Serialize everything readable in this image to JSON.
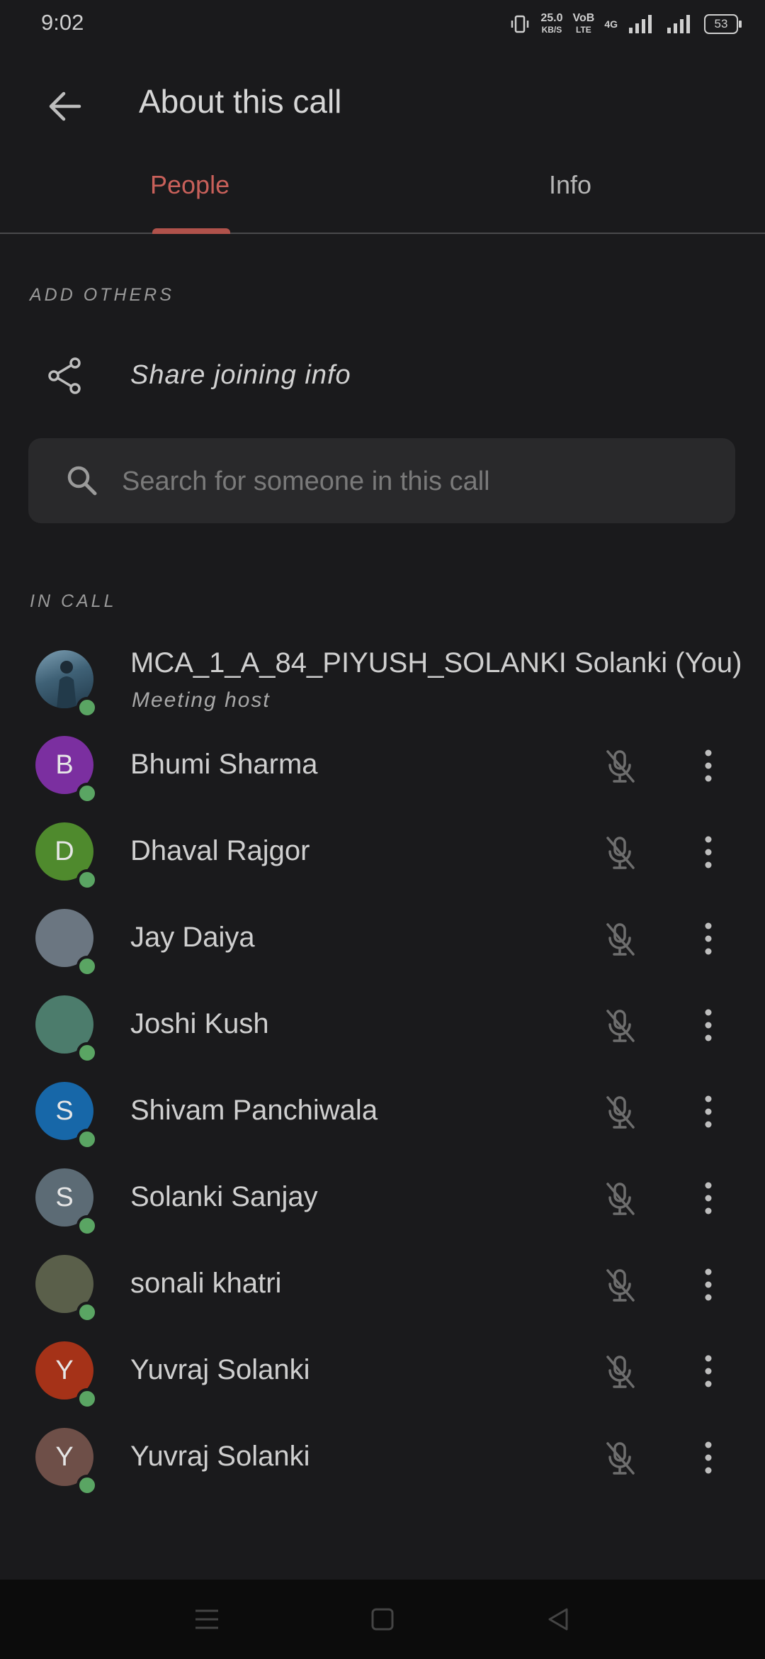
{
  "status_bar": {
    "time": "9:02",
    "speed_value": "25.0",
    "speed_unit": "KB/S",
    "volte_top": "VoB",
    "volte_bottom": "LTE",
    "network": "4G",
    "battery": "53"
  },
  "app_bar": {
    "title": "About this call",
    "back_icon": "arrow-back-icon"
  },
  "tabs": [
    {
      "label": "People",
      "active": true
    },
    {
      "label": "Info",
      "active": false
    }
  ],
  "add_others": {
    "section_label": "ADD OTHERS",
    "share_label": "Share joining info",
    "share_icon": "share-icon"
  },
  "search": {
    "placeholder": "Search for someone in this call",
    "icon": "search-icon"
  },
  "in_call": {
    "section_label": "IN CALL",
    "host": {
      "name": "MCA_1_A_84_PIYUSH_SOLANKI Solanki (You)",
      "subtitle": "Meeting host"
    },
    "participants": [
      {
        "name": "Bhumi Sharma",
        "initial": "B",
        "color": "#7b2fa0"
      },
      {
        "name": "Dhaval Rajgor",
        "initial": "D",
        "color": "#4f8a2d"
      },
      {
        "name": "Jay Daiya",
        "initial": "",
        "color": "#6b7681"
      },
      {
        "name": "Joshi Kush",
        "initial": "",
        "color": "#4c7c6c"
      },
      {
        "name": "Shivam Panchiwala",
        "initial": "S",
        "color": "#1767a8"
      },
      {
        "name": "Solanki Sanjay",
        "initial": "S",
        "color": "#5c6b75"
      },
      {
        "name": "sonali khatri",
        "initial": "",
        "color": "#5a5f4a"
      },
      {
        "name": "Yuvraj Solanki",
        "initial": "Y",
        "color": "#a53218"
      },
      {
        "name": "Yuvraj Solanki",
        "initial": "Y",
        "color": "#6e4f48"
      }
    ]
  },
  "colors": {
    "background": "#1a1a1c",
    "accent": "#c8605a",
    "online": "#5aa563"
  }
}
